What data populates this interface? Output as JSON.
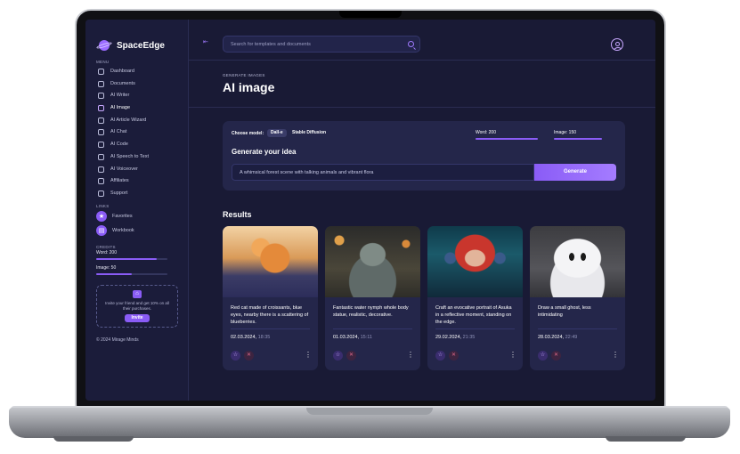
{
  "app": {
    "name": "SpaceEdge"
  },
  "sidebar": {
    "menu_label": "MENU",
    "items": [
      {
        "label": "Dashboard",
        "icon": "grid-icon",
        "active": false
      },
      {
        "label": "Documents",
        "icon": "document-icon",
        "active": false
      },
      {
        "label": "AI Writer",
        "icon": "pen-icon",
        "active": false
      },
      {
        "label": "AI Image",
        "icon": "image-icon",
        "active": true
      },
      {
        "label": "AI Article Wizard",
        "icon": "wand-icon",
        "active": false
      },
      {
        "label": "AI Chat",
        "icon": "chat-icon",
        "active": false
      },
      {
        "label": "AI Code",
        "icon": "code-icon",
        "active": false
      },
      {
        "label": "AI Speech to Text",
        "icon": "microphone-icon",
        "active": false
      },
      {
        "label": "AI Voiceover",
        "icon": "waveform-icon",
        "active": false
      },
      {
        "label": "Affiliates",
        "icon": "share-icon",
        "active": false
      },
      {
        "label": "Support",
        "icon": "support-icon",
        "active": false
      }
    ],
    "links_label": "LINKS",
    "links": [
      {
        "label": "Favorites",
        "icon": "star-icon"
      },
      {
        "label": "Workbook",
        "icon": "book-icon"
      }
    ],
    "credits_label": "CREDITS",
    "credits": [
      {
        "label": "Word: 200",
        "fraction": 0.85
      },
      {
        "label": "Image: 50",
        "fraction": 0.5
      }
    ],
    "invite": {
      "text": "Invite your friend and get 10% on all their purchases.",
      "button": "Invite"
    },
    "copyright": "© 2024 Mirage Minds"
  },
  "header": {
    "search_placeholder": "Search for templates and documents"
  },
  "page": {
    "eyebrow": "GENERATE IMAGES",
    "title": "AI image"
  },
  "generator": {
    "model_label": "Choose model:",
    "models": [
      {
        "label": "Dall-e",
        "selected": true
      },
      {
        "label": "Stable Diffusion",
        "selected": false
      }
    ],
    "quotas": [
      {
        "label": "Word: 200",
        "fraction": 1.0
      },
      {
        "label": "Image: 150",
        "fraction": 1.0
      }
    ],
    "heading": "Generate your idea",
    "prompt_value": "A whimsical forest scene with talking animals and vibrant flora",
    "generate_button": "Generate"
  },
  "results": {
    "title": "Results",
    "cards": [
      {
        "description": "Red cat made of croissants, blue eyes, nearby there is a scattering of blueberries.",
        "date": "02.03.2024,",
        "time": "18:35"
      },
      {
        "description": "Fantastic water nymph whole body statue, realistic, decorative.",
        "date": "01.03.2024,",
        "time": "15:11"
      },
      {
        "description": "Craft an evocative portrait of Asuka in a reflective moment, standing on the edge.",
        "date": "29.02.2024,",
        "time": "21:35"
      },
      {
        "description": "Draw a small ghost, less intimidating",
        "date": "28.03.2024,",
        "time": "22:49"
      }
    ]
  },
  "colors": {
    "accent": "#8a5cf6",
    "background": "#191a35",
    "card": "#24264a"
  }
}
